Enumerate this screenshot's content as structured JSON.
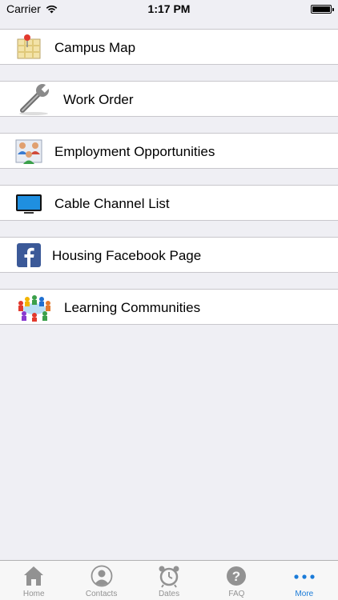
{
  "status_bar": {
    "carrier": "Carrier",
    "time": "1:17 PM"
  },
  "menu": {
    "items": [
      {
        "label": "Campus Map",
        "icon": "map-icon"
      },
      {
        "label": "Work Order",
        "icon": "wrench-icon"
      },
      {
        "label": "Employment Opportunities",
        "icon": "people-icon"
      },
      {
        "label": "Cable Channel List",
        "icon": "tv-icon"
      },
      {
        "label": "Housing Facebook Page",
        "icon": "facebook-icon"
      },
      {
        "label": "Learning Communities",
        "icon": "community-icon"
      }
    ]
  },
  "tab_bar": {
    "tabs": [
      {
        "label": "Home",
        "icon": "home-icon"
      },
      {
        "label": "Contacts",
        "icon": "contacts-icon"
      },
      {
        "label": "Dates",
        "icon": "alarm-clock-icon"
      },
      {
        "label": "FAQ",
        "icon": "question-icon"
      },
      {
        "label": "More",
        "icon": "more-icon",
        "active": true
      }
    ]
  },
  "colors": {
    "accent": "#1a7bd8",
    "background": "#efeff4"
  }
}
